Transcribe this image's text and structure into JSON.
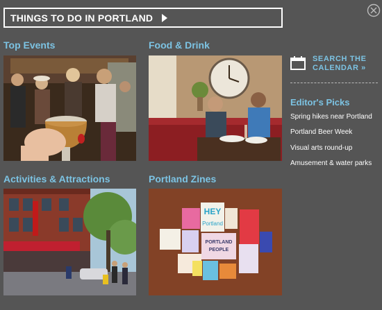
{
  "header": {
    "title": "THINGS TO DO IN PORTLAND"
  },
  "sections": [
    {
      "title": "Top Events"
    },
    {
      "title": "Food & Drink"
    },
    {
      "title": "Activities & Attractions"
    },
    {
      "title": "Portland Zines"
    }
  ],
  "sidebar": {
    "search_calendar_line1": "SEARCH THE",
    "search_calendar_line2": "CALENDAR »",
    "editors_title": "Editor's Picks",
    "picks": [
      "Spring hikes near Portland",
      "Portland Beer Week",
      "Visual arts round-up",
      "Amusement & water parks"
    ]
  },
  "zines": {
    "hey_top": "HEY",
    "hey_bottom": "Portland",
    "people_top": "PORTLAND",
    "people_bottom": "PEOPLE"
  },
  "colors": {
    "background": "#555555",
    "accent": "#7cc3e3",
    "text": "#ffffff"
  }
}
